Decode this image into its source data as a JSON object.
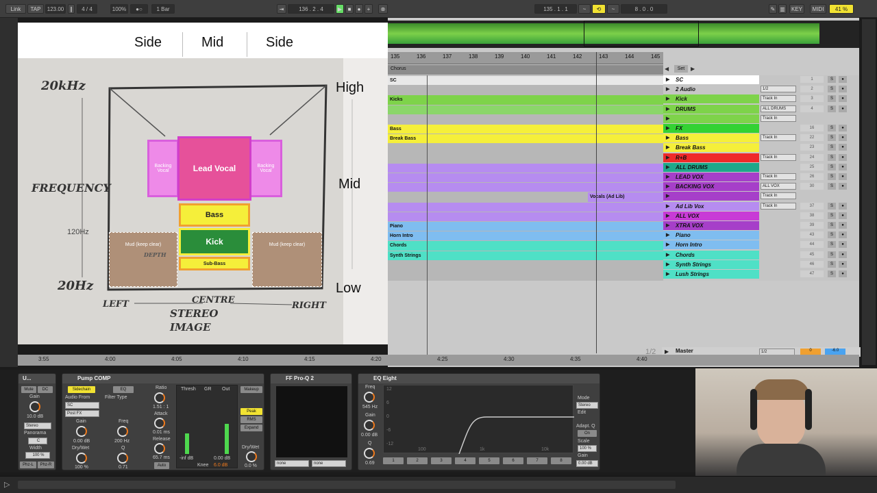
{
  "transport": {
    "link": "Link",
    "tap": "TAP",
    "bpm": "123.00",
    "sig_num": "4",
    "sig_den": "4",
    "zoom": "100%",
    "quant": "1 Bar",
    "position": "136 .  2 .  4",
    "loop_start": "135 .  1 .  1",
    "loop_len": "8 .  0 .  0",
    "key": "KEY",
    "midi": "MIDI",
    "cpu": "41 %"
  },
  "diagram": {
    "headers": [
      "Side",
      "Mid",
      "Side"
    ],
    "right_labels": [
      "High",
      "Mid",
      "Low"
    ],
    "left_labels": [
      "20kHz",
      "FREQUENCY",
      "120Hz",
      "20Hz"
    ],
    "bottom_labels": [
      "LEFT",
      "CENTRE",
      "RIGHT",
      "STEREO",
      "IMAGE"
    ],
    "blocks": {
      "lead": "Lead Vocal",
      "backing": "Backing Vocal",
      "bass": "Bass",
      "kick": "Kick",
      "sub": "Sub-Bass",
      "mud": "Mud (keep clear)",
      "depth": "DEPTH"
    }
  },
  "arrangement": {
    "bars": [
      "135",
      "136",
      "137",
      "138",
      "139",
      "140",
      "141",
      "142",
      "143",
      "144",
      "145"
    ],
    "locator": "Chorus",
    "time_ticks": [
      "3:55",
      "4:00",
      "4:05",
      "4:10",
      "4:15",
      "4:20",
      "4:25",
      "4:30",
      "4:35",
      "4:40"
    ],
    "page": "1/2",
    "set_button": "Set",
    "clips": [
      {
        "name": "SC",
        "color": "#e8e8e8"
      },
      {
        "name": "",
        "color": "#b7b7b7"
      },
      {
        "name": "Kicks",
        "color": "#7ed34a"
      },
      {
        "name": "",
        "color": "#8bd66a"
      },
      {
        "name": "",
        "color": "#b7b7b7"
      },
      {
        "name": "Bass",
        "color": "#f5ef3a"
      },
      {
        "name": "Break Bass",
        "color": "#f5ef3a"
      },
      {
        "name": "",
        "color": "#b7b7b7"
      },
      {
        "name": "",
        "color": "#b7b7b7"
      },
      {
        "name": "",
        "color": "#b68cf0"
      },
      {
        "name": "",
        "color": "#b68cf0"
      },
      {
        "name": "",
        "color": "#b68cf0"
      },
      {
        "name": "Vocals (Ad Lib)",
        "color": "#b68cf0"
      },
      {
        "name": "",
        "color": "#b68cf0"
      },
      {
        "name": "",
        "color": "#b68cf0"
      },
      {
        "name": "Piano",
        "color": "#7fbdf0"
      },
      {
        "name": "Horn Intro",
        "color": "#7fbdf0"
      },
      {
        "name": "Chords",
        "color": "#4fe0c6"
      },
      {
        "name": "Synth Strings",
        "color": "#4fe0c6"
      }
    ],
    "tracks": [
      {
        "name": "SC",
        "color": "#ffffff",
        "num": "1"
      },
      {
        "name": "2 Audio",
        "color": "#c6c6c6",
        "num": "2",
        "io": "1/2"
      },
      {
        "name": "Kick",
        "color": "#7ed34a",
        "num": "3",
        "io": "Track In"
      },
      {
        "name": "DRUMS",
        "color": "#7ed34a",
        "num": "4",
        "io": "ALL DRUMS"
      },
      {
        "name": "",
        "color": "#7ed34a",
        "num": "",
        "io": "Track In"
      },
      {
        "name": "FX",
        "color": "#33d233",
        "num": "16",
        "io": ""
      },
      {
        "name": "Bass",
        "color": "#f5ef3a",
        "num": "22",
        "io": "Track In"
      },
      {
        "name": "Break Bass",
        "color": "#f5ef3a",
        "num": "23",
        "io": ""
      },
      {
        "name": "R+B",
        "color": "#ef2a2a",
        "num": "24",
        "io": "Track In"
      },
      {
        "name": "ALL DRUMS",
        "color": "#1fa88a",
        "num": "25",
        "io": ""
      },
      {
        "name": "LEAD VOX",
        "color": "#a63fc9",
        "num": "26",
        "io": "Track In"
      },
      {
        "name": "BACKING VOX",
        "color": "#a63fc9",
        "num": "30",
        "io": "ALL VOX"
      },
      {
        "name": "",
        "color": "#a63fc9",
        "num": "",
        "io": "Track In"
      },
      {
        "name": "Ad Lib Vox",
        "color": "#b68cf0",
        "num": "37",
        "io": "Track In"
      },
      {
        "name": "ALL VOX",
        "color": "#c83bd6",
        "num": "38",
        "io": ""
      },
      {
        "name": "XTRA VOX",
        "color": "#a63fc9",
        "num": "39",
        "io": ""
      },
      {
        "name": "Piano",
        "color": "#7fbdf0",
        "num": "43",
        "io": ""
      },
      {
        "name": "Horn Intro",
        "color": "#7fbdf0",
        "num": "44",
        "io": ""
      },
      {
        "name": "Chords",
        "color": "#4fe0c6",
        "num": "45",
        "io": ""
      },
      {
        "name": "Synth Strings",
        "color": "#4fe0c6",
        "num": "46",
        "io": ""
      },
      {
        "name": "Lush Strings",
        "color": "#4fe0c6",
        "num": "47",
        "io": ""
      }
    ],
    "master": {
      "name": "Master",
      "io": "1/2",
      "num": "0",
      "vol": "-6.0"
    }
  },
  "devices": {
    "utility": {
      "title": "U...",
      "mute": "Mute",
      "dc": "DC",
      "gain_label": "Gain",
      "gain": "10.0 dB",
      "stereo": "Stereo",
      "panorama": "Panorama",
      "pan": "C",
      "width_label": "Width",
      "width": "100 %",
      "phz_l": "Phz-L",
      "phz_r": "Phz-R"
    },
    "comp": {
      "title": "Pump COMP",
      "sidechain": "Sidechain",
      "eq": "EQ",
      "audio_from": "Audio From",
      "src": "SC",
      "post": "Post FX",
      "gain_label": "Gain",
      "gain": "0.00 dB",
      "drywet_label": "Dry/Wet",
      "drywet": "100 %",
      "filter_type": "Filter Type",
      "freq_label": "Freq",
      "freq": "200 Hz",
      "q_label": "Q",
      "q": "0.71",
      "ratio_label": "Ratio",
      "ratio": "1.51 : 1",
      "attack_label": "Attack",
      "attack": "0.01 ms",
      "release_label": "Release",
      "release": "65.7 ms",
      "auto": "Auto",
      "thresh": "Thresh",
      "gr": "GR",
      "out": "Out",
      "thresh_val": "-inf dB",
      "gr_val": "0.00 dB",
      "knee": "Knee",
      "knee_val": "6.0 dB",
      "makeup": "Makeup",
      "peak": "Peak",
      "rms": "RMS",
      "expand": "Expand",
      "dw_label": "Dry/Wet",
      "dw": "0.0 %"
    },
    "proq": {
      "title": "FF Pro-Q 2",
      "sel1": "none",
      "sel2": "none"
    },
    "eq8": {
      "title": "EQ Eight",
      "freq_label": "Freq",
      "freq": "545 Hz",
      "gain_label": "Gain",
      "gain": "0.00 dB",
      "q_label": "Q",
      "q": "0.69",
      "mode": "Mode",
      "stereo": "Stereo",
      "edit": "Edit",
      "adapt": "Adapt. Q",
      "on": "On",
      "scale_label": "Scale",
      "scale": "100 %",
      "gain2_label": "Gain",
      "gain2": "0.00 dB",
      "grid": [
        "12",
        "6",
        "0",
        "-6",
        "-12"
      ],
      "freqs": [
        "100",
        "1k",
        "10k"
      ],
      "bands": [
        "1",
        "2",
        "3",
        "4",
        "5",
        "6",
        "7",
        "8"
      ]
    }
  }
}
